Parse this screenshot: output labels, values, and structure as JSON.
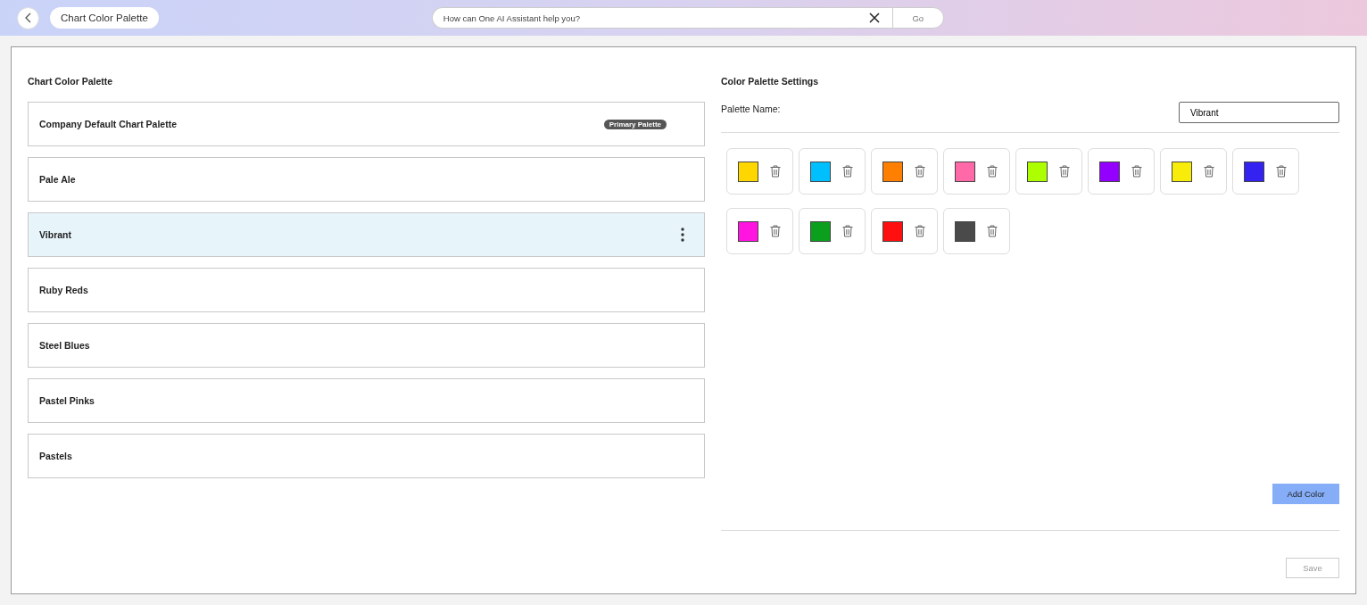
{
  "header": {
    "page_title": "Chart Color Palette",
    "search": {
      "placeholder": "How can One AI Assistant help you?",
      "go_label": "Go"
    }
  },
  "palette_list": {
    "title": "Chart Color Palette",
    "items": [
      {
        "name": "Company Default Chart Palette",
        "badge": "Primary Palette",
        "selected": false
      },
      {
        "name": "Pale Ale",
        "selected": false
      },
      {
        "name": "Vibrant",
        "selected": true
      },
      {
        "name": "Ruby Reds",
        "selected": false
      },
      {
        "name": "Steel Blues",
        "selected": false
      },
      {
        "name": "Pastel Pinks",
        "selected": false
      },
      {
        "name": "Pastels",
        "selected": false
      }
    ]
  },
  "settings": {
    "title": "Color Palette Settings",
    "name_label": "Palette Name:",
    "name_value": "Vibrant",
    "colors": [
      {
        "color": "#ffd700"
      },
      {
        "color": "#00bfff"
      },
      {
        "color": "#ff7f00"
      },
      {
        "color": "#ff69a8"
      },
      {
        "color": "#adff00"
      },
      {
        "color": "#9400ff"
      },
      {
        "color": "#f8ec0a"
      },
      {
        "color": "#3322f0"
      },
      {
        "color": "#ff14e0"
      },
      {
        "color": "#0aa01e"
      },
      {
        "color": "#ff1010"
      },
      {
        "color": "#4a4a4a"
      }
    ],
    "add_label": "Add Color",
    "save": {
      "label": "Save",
      "disabled": true
    }
  }
}
